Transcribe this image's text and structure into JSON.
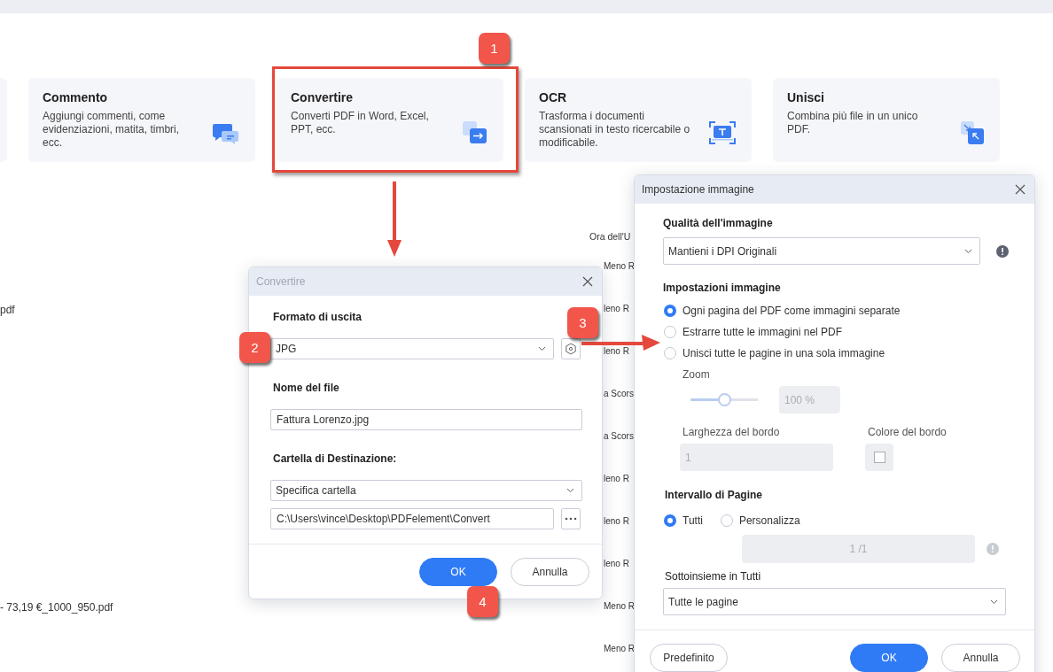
{
  "cards": [
    {
      "kind": "comment",
      "title": "Commento",
      "description": "Aggiungi commenti, come evidenziazioni, matita, timbri, ecc.",
      "highlighted": false
    },
    {
      "kind": "convert",
      "title": "Convertire",
      "description": "Converti PDF in Word, Excel, PPT, ecc.",
      "highlighted": true
    },
    {
      "kind": "ocr",
      "title": "OCR",
      "description": "Trasforma i documenti scansionati in testo ricercabile o modificabile.",
      "highlighted": false
    },
    {
      "kind": "merge",
      "title": "Unisci",
      "description": "Combina più file in un unico PDF.",
      "highlighted": false
    }
  ],
  "file_list": {
    "header": "Ora dell'U",
    "rows": [
      {
        "column_2": "Meno R"
      },
      {
        "name": "pdf",
        "column_2": "leno R"
      },
      {
        "column_2": "leno R"
      },
      {
        "column_2": "a Scors"
      },
      {
        "column_2": "a Scors"
      },
      {
        "column_2": "leno R"
      },
      {
        "column_2": "leno R"
      },
      {
        "column_2": "leno R"
      },
      {
        "name": "- 73,19 €_1000_950.pdf",
        "column_2": "Meno R"
      },
      {
        "column_2": "Meno R"
      }
    ]
  },
  "convert_dialog": {
    "title": "Convertire",
    "format_label": "Formato di uscita",
    "format_value": "JPG",
    "file_name_label": "Nome del file",
    "file_name_value": "Fattura Lorenzo.jpg",
    "folder_label": "Cartella di Destinazione:",
    "folder_option": "Specifica cartella",
    "folder_path": "C:\\Users\\vince\\Desktop\\PDFelement\\Convert",
    "ok": "OK",
    "cancel": "Annulla"
  },
  "image_dialog": {
    "title": "Impostazione immagine",
    "quality_label": "Qualità dell'immagine",
    "quality_value": "Mantieni i DPI Originali",
    "settings_label": "Impostazioni immagine",
    "image_options": [
      {
        "label": "Ogni pagina del PDF come immagini separate",
        "selected": true
      },
      {
        "label": "Estrarre tutte le immagini nel PDF",
        "selected": false
      },
      {
        "label": "Unisci tutte le pagine in una sola immagine",
        "selected": false
      }
    ],
    "zoom": {
      "label": "Zoom",
      "level": 0.5,
      "value": "100 %",
      "disabled": true
    },
    "border_width": {
      "label": "Larghezza del bordo",
      "value": "1",
      "disabled": true
    },
    "border_color": {
      "label": "Colore del bordo",
      "disabled": true
    },
    "page_range_label": "Intervallo di Pagine",
    "page_range_options": [
      {
        "label": "Tutti",
        "selected": true
      },
      {
        "label": "Personalizza",
        "selected": false
      }
    ],
    "page_range_field": {
      "value": "1 /1",
      "disabled": true
    },
    "subset_label": "Sottoinsieme in Tutti",
    "subset_value": "Tutte le pagine",
    "default_button": "Predefinito",
    "ok": "OK",
    "cancel": "Annulla"
  },
  "annotations": [
    {
      "label": "1"
    },
    {
      "label": "2"
    },
    {
      "label": "3"
    },
    {
      "label": "4"
    }
  ]
}
